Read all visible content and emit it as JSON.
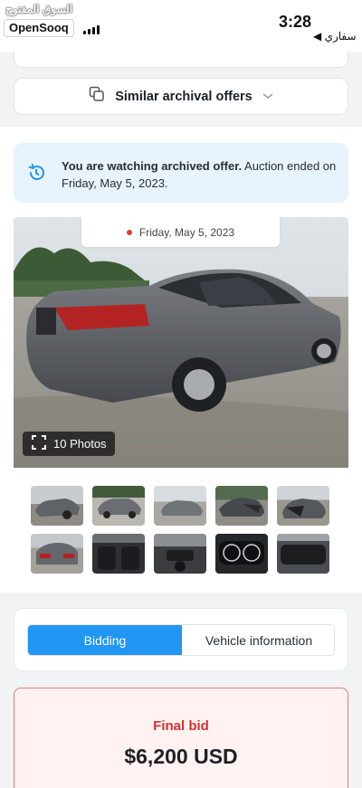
{
  "status_bar": {
    "watermark": "السوق المفتوح",
    "brand": "OpenSooq",
    "time": "3:28",
    "back_app": "◀ سفاري"
  },
  "similar": {
    "label": "Similar archival offers",
    "icon": "copy-icon",
    "chevron": "chevron-down-icon"
  },
  "notice": {
    "icon": "history-icon",
    "bold_text": "You are watching archived offer.",
    "text": " Auction ended on Friday, May 5, 2023."
  },
  "photo": {
    "date": "Friday, May 5, 2023",
    "photos_label": "10 Photos",
    "expand_icon": "expand-icon"
  },
  "thumbnails": [
    {
      "alt": "rear quarter view"
    },
    {
      "alt": "side view"
    },
    {
      "alt": "front view in lot"
    },
    {
      "alt": "damaged front"
    },
    {
      "alt": "front damage close"
    },
    {
      "alt": "rear view"
    },
    {
      "alt": "interior front seats"
    },
    {
      "alt": "dashboard"
    },
    {
      "alt": "instrument cluster"
    },
    {
      "alt": "rear seats"
    }
  ],
  "tabs": [
    {
      "label": "Bidding",
      "active": true
    },
    {
      "label": "Vehicle information",
      "active": false
    }
  ],
  "final_bid": {
    "label": "Final bid",
    "amount": "$6,200 USD"
  },
  "colors": {
    "accent": "#2196f3",
    "notice_bg": "#e7f4fd",
    "bid_red": "#d32f2f",
    "bid_bg": "#fff2f1"
  }
}
